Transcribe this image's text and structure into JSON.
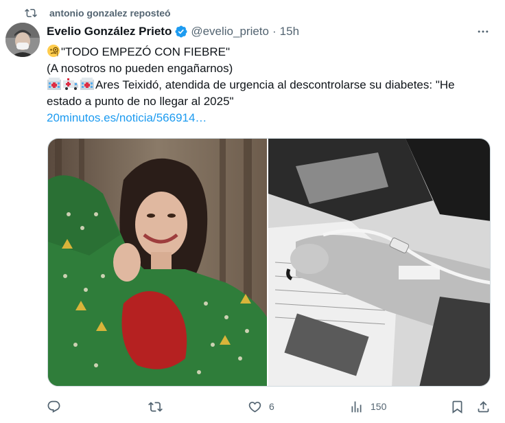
{
  "repost": {
    "label": "antonio gonzalez reposteó"
  },
  "author": {
    "name": "Evelio González Prieto",
    "handle": "@evelio_prieto",
    "separator": "·",
    "time": "15h"
  },
  "post": {
    "line1": "\"TODO EMPEZÓ CON FIEBRE\"",
    "line2": "(A nosotros no pueden engañarnos)",
    "line3": "Ares Teixidó, atendida de urgencia al descontrolarse su diabetes: \"He estado a punto de no llegar al 2025\"",
    "link": "20minutos.es/noticia/566914…"
  },
  "media": {
    "left_description": "woman-in-green-christmas-sweater",
    "right_description": "arm-with-iv-drip-black-and-white"
  },
  "actions": {
    "reply_count": "",
    "repost_count": "",
    "like_count": "6",
    "views_count": "150"
  },
  "icons": {
    "repost": "repost-icon",
    "verified": "verified-badge-icon",
    "more": "more-icon",
    "reply": "reply-icon",
    "like": "like-icon",
    "views": "views-icon",
    "bookmark": "bookmark-icon",
    "share": "share-icon",
    "emoji_monocle": "monocle-face-emoji",
    "emoji_hospital": "hospital-emoji",
    "emoji_ambulance": "ambulance-emoji"
  },
  "colors": {
    "accent": "#1d9bf0",
    "muted": "#536471",
    "text": "#0f1419"
  }
}
